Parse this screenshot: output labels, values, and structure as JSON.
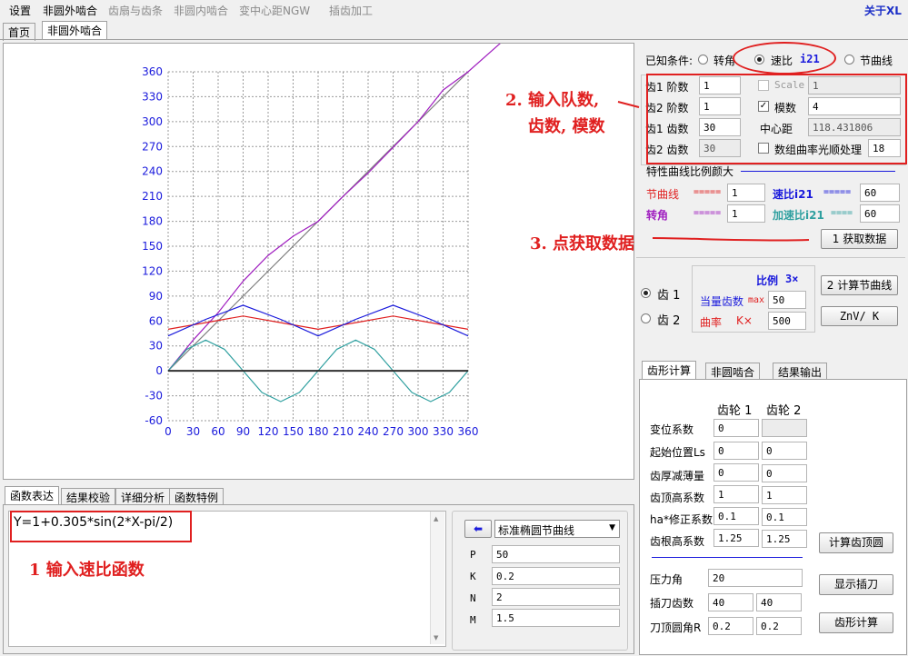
{
  "menu": {
    "items": [
      {
        "label": "设置",
        "enabled": true
      },
      {
        "label": "非圆外啮合",
        "enabled": true
      },
      {
        "label": "齿扇与齿条",
        "enabled": false
      },
      {
        "label": "非圆内啮合",
        "enabled": false
      },
      {
        "label": "变中心距NGW",
        "enabled": false
      },
      {
        "label": "插齿加工",
        "enabled": false
      }
    ],
    "about": "关于XL"
  },
  "top_tabs": [
    "首页",
    "非圆外啮合"
  ],
  "conditions": {
    "label": "已知条件:",
    "options": [
      "转角",
      "速比",
      "i21",
      "节曲线"
    ],
    "selected": "速比"
  },
  "gear_params": {
    "order1_label": "齿1 阶数",
    "order1": "1",
    "order2_label": "齿2 阶数",
    "order2": "1",
    "teeth1_label": "齿1 齿数",
    "teeth1": "30",
    "teeth2_label": "齿2 齿数",
    "teeth2": "30",
    "scale_label": "Scale",
    "scale": "1",
    "module_label": "模数",
    "module": "4",
    "center_label": "中心距",
    "center": "118.431806",
    "smooth_label": "数组曲率光顺处理",
    "smooth": "18"
  },
  "ratio_section": {
    "title": "特性曲线比例颜大",
    "pitch_label": "节曲线",
    "pitch_marks": "=====",
    "pitch_value": "1",
    "ratio_label": "速比i21",
    "ratio_marks": "=====",
    "ratio_value": "60",
    "angle_label": "转角",
    "angle_marks": "=====",
    "angle_value": "1",
    "accel_label": "加速比i21",
    "accel_marks": "====",
    "accel_value": "60",
    "get_button": "1 获取数据"
  },
  "gear_select": {
    "gear1": "齿 1",
    "gear2": "齿 2",
    "scale_title": "比例",
    "scale_value": "3×",
    "equiv_label": "当量齿数",
    "max_label": "max",
    "equiv_value": "50",
    "curv_label": "曲率",
    "k_label": "K×",
    "curv_value": "500",
    "calc_pitch_button": "2 计算节曲线",
    "znv_button": "ZnV/ K"
  },
  "tooth_tabs": [
    "齿形计算",
    "非圆啮合",
    "结果输出"
  ],
  "tooth_calc": {
    "gear1_header": "齿轮 1",
    "gear2_header": "齿轮 2",
    "rows": [
      {
        "label": "变位系数",
        "v1": "0",
        "v2": ""
      },
      {
        "label": "起始位置Ls",
        "v1": "0",
        "v2": "0"
      },
      {
        "label": "齿厚减薄量",
        "v1": "0",
        "v2": "0"
      },
      {
        "label": "齿顶高系数",
        "v1": "1",
        "v2": "1"
      },
      {
        "label": "ha*修正系数",
        "v1": "0.1",
        "v2": "0.1"
      },
      {
        "label": "齿根高系数",
        "v1": "1.25",
        "v2": "1.25"
      }
    ],
    "pressure_label": "压力角",
    "pressure": "20",
    "cutter_label": "插刀齿数",
    "cutter1": "40",
    "cutter2": "40",
    "tip_label": "刀顶圆角R",
    "tip1": "0.2",
    "tip2": "0.2",
    "calc_tip_button": "计算齿顶圆",
    "show_cutter_button": "显示插刀",
    "calc_tooth_button": "齿形计算"
  },
  "bottom_tabs": [
    "函数表达",
    "结果校验",
    "详细分析",
    "函数特例"
  ],
  "function": {
    "expression": "Y=1+0.305*sin(2*X-pi/2)",
    "preset": "标准椭圆节曲线",
    "params": [
      {
        "name": "P",
        "value": "50"
      },
      {
        "name": "K",
        "value": "0.2"
      },
      {
        "name": "N",
        "value": "2"
      },
      {
        "name": "M",
        "value": "1.5"
      }
    ]
  },
  "annotations": {
    "note1": "1  输入速比函数",
    "note2a": "2. 输入队数,",
    "note2b": "齿数, 模数",
    "note3": "3. 点获取数据"
  },
  "colors": {
    "annotation": "#e02020",
    "axis_label": "#1a1adc"
  },
  "chart_data": {
    "type": "line",
    "xlim": [
      0,
      360
    ],
    "ylim": [
      -60,
      360
    ],
    "xticks": [
      0,
      30,
      60,
      90,
      120,
      150,
      180,
      210,
      240,
      270,
      300,
      330,
      360
    ],
    "yticks": [
      -60,
      -30,
      0,
      30,
      60,
      90,
      120,
      150,
      180,
      210,
      240,
      270,
      300,
      330,
      360
    ],
    "grid": true,
    "series": [
      {
        "color": "#808080",
        "x": [
          0,
          360
        ],
        "y": [
          0,
          360
        ]
      },
      {
        "color": "#a020c0",
        "x": [
          0,
          30,
          60,
          90,
          120,
          150,
          180,
          210,
          240,
          270,
          300,
          330,
          360,
          405
        ],
        "y": [
          0,
          37,
          70,
          108,
          139,
          162,
          180,
          210,
          238,
          269,
          300,
          338,
          360,
          400
        ]
      },
      {
        "color": "#e02020",
        "x": [
          0,
          45,
          90,
          135,
          180,
          225,
          270,
          315,
          360
        ],
        "y": [
          50,
          58,
          66,
          58,
          50,
          58,
          66,
          58,
          50
        ]
      },
      {
        "color": "#1a1adc",
        "x": [
          0,
          45,
          90,
          135,
          180,
          225,
          270,
          315,
          360
        ],
        "y": [
          42,
          62,
          79,
          62,
          42,
          62,
          79,
          62,
          42
        ]
      },
      {
        "color": "#30a0a0",
        "x": [
          0,
          22.5,
          45,
          67.5,
          90,
          112.5,
          135,
          157.5,
          180,
          202.5,
          225,
          247.5,
          270,
          292.5,
          315,
          337.5,
          360
        ],
        "y": [
          0,
          26,
          37,
          26,
          0,
          -26,
          -37,
          -26,
          0,
          26,
          37,
          26,
          0,
          -26,
          -37,
          -26,
          0
        ]
      },
      {
        "color": "#303030",
        "x": [
          0,
          360
        ],
        "y": [
          0,
          0
        ]
      }
    ]
  }
}
